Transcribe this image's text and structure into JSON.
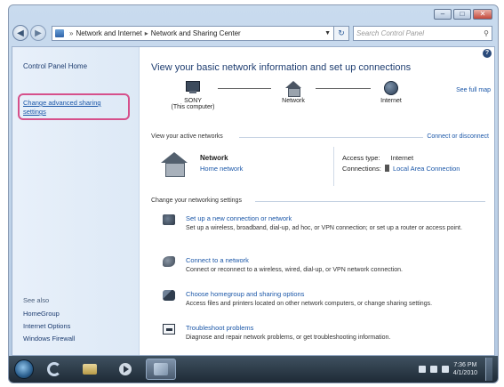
{
  "window": {
    "caption_buttons": [
      "minimize",
      "maximize",
      "close"
    ]
  },
  "address_bar": {
    "crumbs": [
      "Network and Internet",
      "Network and Sharing Center"
    ],
    "search_placeholder": "Search Control Panel"
  },
  "left_pane": {
    "home_label": "Control Panel Home",
    "advanced_link": "Change advanced sharing settings",
    "see_also_label": "See also",
    "see_also_items": [
      "HomeGroup",
      "Internet Options",
      "Windows Firewall"
    ]
  },
  "main": {
    "title": "View your basic network information and set up connections",
    "see_full_map": "See full map",
    "map_nodes": {
      "computer_name": "SONY",
      "computer_sub": "(This computer)",
      "network_label": "Network",
      "internet_label": "Internet"
    },
    "active_networks": {
      "header": "View your active networks",
      "connect_link": "Connect or disconnect",
      "network_name": "Network",
      "network_type": "Home network",
      "access_type_label": "Access type:",
      "access_type_value": "Internet",
      "connections_label": "Connections:",
      "connections_value": "Local Area Connection"
    },
    "settings": {
      "header": "Change your networking settings",
      "tasks": [
        {
          "title": "Set up a new connection or network",
          "desc": "Set up a wireless, broadband, dial-up, ad hoc, or VPN connection; or set up a router or access point.",
          "icon": "new-connection-icon"
        },
        {
          "title": "Connect to a network",
          "desc": "Connect or reconnect to a wireless, wired, dial-up, or VPN network connection.",
          "icon": "connect-network-icon"
        },
        {
          "title": "Choose homegroup and sharing options",
          "desc": "Access files and printers located on other network computers, or change sharing settings.",
          "icon": "homegroup-icon"
        },
        {
          "title": "Troubleshoot problems",
          "desc": "Diagnose and repair network problems, or get troubleshooting information.",
          "icon": "troubleshoot-icon"
        }
      ]
    }
  },
  "taskbar": {
    "time": "7:36 PM",
    "date": "4/1/2010"
  },
  "colors": {
    "link": "#1b57a8",
    "highlight": "#d6508b",
    "title": "#1e3d70"
  }
}
